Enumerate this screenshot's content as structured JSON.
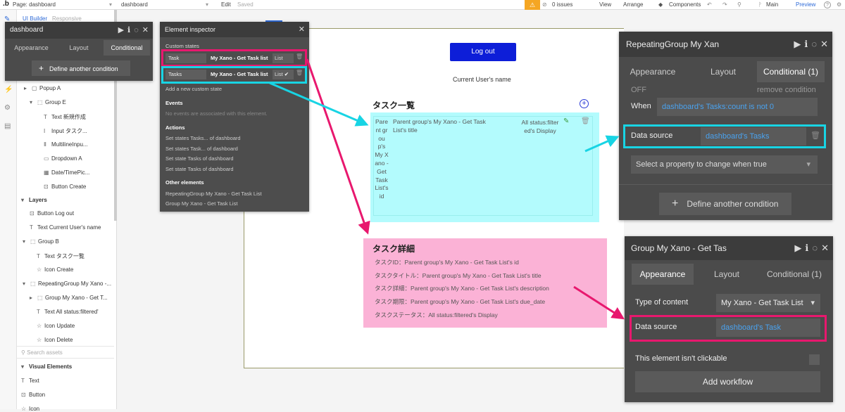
{
  "topbar": {
    "logo": ".b",
    "page_label": "Page: dashboard",
    "page_dropdown": "dashboard",
    "edit": "Edit",
    "saved": "Saved",
    "issues": "0 issues",
    "view": "View",
    "arrange": "Arrange",
    "components": "Components",
    "main": "Main",
    "preview": "Preview",
    "help": "?"
  },
  "tree": {
    "builder_label": "UI Builder",
    "responsive_label": "Responsive",
    "items": [
      {
        "icon": "▢",
        "label": "Popup A"
      },
      {
        "icon": "⬚",
        "label": "Group E"
      },
      {
        "icon": "T",
        "label": "Text 新規作成"
      },
      {
        "icon": "I",
        "label": "Input タスク..."
      },
      {
        "icon": "Ⅱ",
        "label": "MultilineInpu..."
      },
      {
        "icon": "▭",
        "label": "Dropdown A"
      },
      {
        "icon": "▦",
        "label": "Date/TimePic..."
      },
      {
        "icon": "⊡",
        "label": "Button Create"
      }
    ],
    "layers_label": "Layers",
    "layers": [
      {
        "icon": "⊡",
        "label": "Button Log out"
      },
      {
        "icon": "T",
        "label": "Text Current User's name"
      },
      {
        "icon": "⬚",
        "label": "Group B"
      },
      {
        "icon": "T",
        "label": "Text タスク一覧"
      },
      {
        "icon": "☆",
        "label": "Icon Create"
      },
      {
        "icon": "⬚",
        "label": "RepeatingGroup My Xano -..."
      },
      {
        "icon": "⬚",
        "label": "Group My Xano - Get T..."
      },
      {
        "icon": "T",
        "label": "Text All status:filtered'"
      },
      {
        "icon": "☆",
        "label": "Icon Update"
      },
      {
        "icon": "☆",
        "label": "Icon Delete"
      }
    ],
    "search_placeholder": "Search assets",
    "visual_label": "Visual Elements",
    "visual": [
      {
        "icon": "T",
        "label": "Text"
      },
      {
        "icon": "⊡",
        "label": "Button"
      },
      {
        "icon": "☆",
        "label": "Icon"
      }
    ]
  },
  "dash_panel": {
    "title": "dashboard",
    "tabs": [
      "Appearance",
      "Layout",
      "Conditional"
    ],
    "define_button": "Define another condition"
  },
  "inspector": {
    "title": "Element inspector",
    "custom_states_label": "Custom states",
    "states": [
      {
        "name": "Task",
        "type": "My Xano - Get Task list",
        "list": "List"
      },
      {
        "name": "Tasks",
        "type": "My Xano - Get Task list",
        "list": "List"
      }
    ],
    "add_state": "Add a new custom state",
    "events_label": "Events",
    "events_empty": "No events are associated with this element.",
    "actions_label": "Actions",
    "actions": [
      "Set states Tasks... of dashboard",
      "Set states Task... of dashboard",
      "Set state Tasks of dashboard",
      "Set state Tasks of dashboard"
    ],
    "other_label": "Other elements",
    "others": [
      "RepeatingGroup My Xano - Get Task List",
      "Group My Xano - Get Task List"
    ]
  },
  "canvas": {
    "logout": "Log out",
    "user_name": "Current User's name",
    "tasklist_title": "タスク一覧",
    "rg_col1": "Parent group's My Xano - Get Task List's id",
    "rg_col2": "Parent group's My Xano - Get Task List's title",
    "rg_col3": "All status:filtered's Display",
    "detail_title": "タスク詳細",
    "detail_lines": [
      "タスクID：Parent group's My Xano - Get Task List's id",
      "タスクタイトル：Parent group's My Xano - Get Task List's title",
      "タスク詳細：Parent group's My Xano - Get Task List's description",
      "タスク期限：Parent group's My Xano - Get Task List's due_date",
      "タスクステータス：All status:filtered's Display"
    ]
  },
  "rg_panel": {
    "title": "RepeatingGroup My Xan",
    "tabs": [
      "Appearance",
      "Layout",
      "Conditional (1)"
    ],
    "off": "OFF",
    "remove": "remove condition",
    "when_label": "When",
    "when_value": "dashboard's Tasks:count is not 0",
    "ds_label": "Data source",
    "ds_value": "dashboard's Tasks",
    "select_prop": "Select a property to change when true",
    "define_button": "Define another condition"
  },
  "grp_panel": {
    "title": "Group My Xano - Get Tas",
    "tabs": [
      "Appearance",
      "Layout",
      "Conditional (1)"
    ],
    "type_label": "Type of content",
    "type_value": "My Xano - Get Task List",
    "ds_label": "Data source",
    "ds_value": "dashboard's Task",
    "not_clickable": "This element isn't clickable",
    "add_workflow": "Add workflow"
  },
  "colors": {
    "pink": "#e8186e",
    "cyan": "#18d4e4",
    "button_blue": "#0d1ed8",
    "link_blue": "#4aa3f0"
  }
}
